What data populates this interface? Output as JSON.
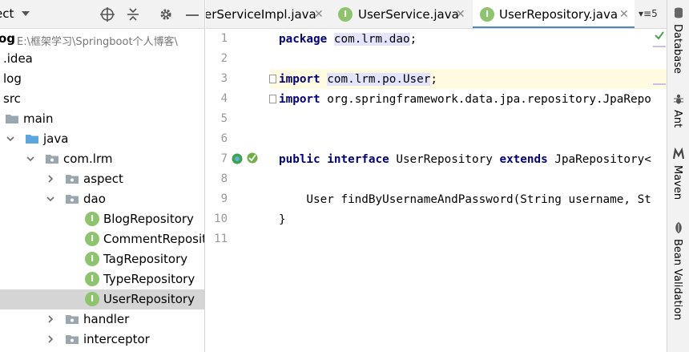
{
  "project": {
    "header": {
      "title": "ect"
    },
    "root": {
      "label": "og",
      "path": "E:\\框架学习\\Springboot个人博客\\"
    },
    "tree": [
      {
        "label": ".idea"
      },
      {
        "label": "log"
      },
      {
        "label": "src"
      },
      {
        "label": "main"
      },
      {
        "label": "java"
      },
      {
        "label": "com.lrm"
      },
      {
        "label": "aspect"
      },
      {
        "label": "dao"
      },
      {
        "label": "BlogRepository"
      },
      {
        "label": "CommentReposit"
      },
      {
        "label": "TagRepository"
      },
      {
        "label": "TypeRepository"
      },
      {
        "label": "UserRepository"
      },
      {
        "label": "handler"
      },
      {
        "label": "interceptor"
      }
    ],
    "interface_letter": "I"
  },
  "tabs": [
    {
      "label": "erServiceImpl.java",
      "close": "✕"
    },
    {
      "label": "UserService.java",
      "close": "✕"
    },
    {
      "label": "UserRepository.java",
      "close": "✕"
    }
  ],
  "tab_overflow": "▾≡5",
  "editor": {
    "line_numbers": [
      "1",
      "2",
      "3",
      "4",
      "5",
      "6",
      "7",
      "8",
      "9",
      "10",
      "11"
    ],
    "code": {
      "l1_kw": "package",
      "l1_pkg": "com.lrm.dao",
      "l1_semi": ";",
      "l3_kw": "import",
      "l3_pkg": "com.lrm.po.User",
      "l3_semi": ";",
      "l4_kw": "import",
      "l4_rest": "org.springframework.data.jpa.repository.JpaRepo",
      "l7_kw1": "public",
      "l7_kw2": "interface",
      "l7_name": "UserRepository",
      "l7_kw3": "extends",
      "l7_rest": "JpaRepository<",
      "l9": "    User findByUsernameAndPassword(String username, St",
      "l10": "}"
    }
  },
  "tool_strip": {
    "items": [
      "Database",
      "Ant",
      "Maven",
      "Bean Validation"
    ]
  },
  "colors": {
    "keyword": "#000080",
    "interface_icon": "#8dc46d",
    "active_tab_underline": "#4a88c7",
    "selection": "#d5d5d5"
  }
}
